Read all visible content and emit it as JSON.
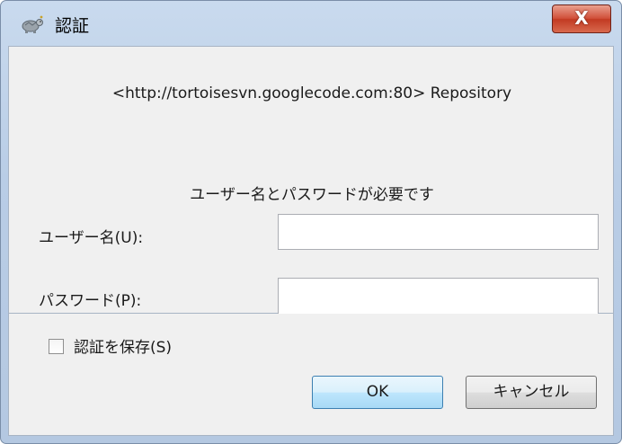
{
  "window": {
    "title": "認証",
    "close_label": "X"
  },
  "dialog": {
    "realm": "<http://tortoisesvn.googlecode.com:80> Repository",
    "prompt": "ユーザー名とパスワードが必要です",
    "username_label": "ユーザー名(U):",
    "username_value": "",
    "password_label": "パスワード(P):",
    "password_value": "",
    "save_label": "認証を保存(S)",
    "save_checked": false
  },
  "buttons": {
    "ok_label": "OK",
    "cancel_label": "キャンセル"
  },
  "icons": {
    "app": "tortoise-icon",
    "close": "close-icon"
  },
  "colors": {
    "chrome": "#b9cde6",
    "close_button": "#c9442b",
    "panel": "#f0f0f0"
  }
}
